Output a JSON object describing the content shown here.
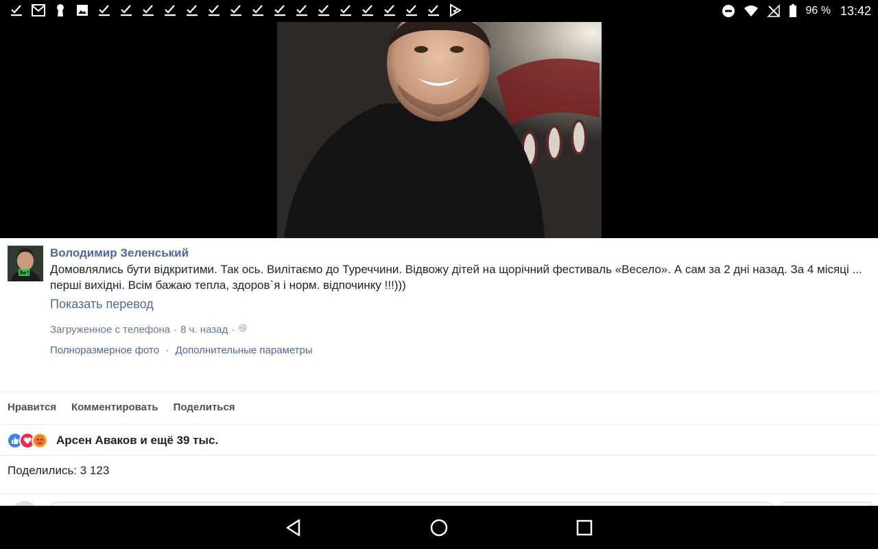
{
  "status_bar": {
    "notification_icons": [
      "check-icon",
      "gmail-icon",
      "keyhole-icon",
      "image-icon",
      "check-icon",
      "check-icon",
      "check-icon",
      "check-icon",
      "check-icon",
      "check-icon",
      "check-icon",
      "check-icon",
      "check-icon",
      "check-icon",
      "check-icon",
      "check-icon",
      "check-icon",
      "check-icon",
      "check-icon",
      "check-icon",
      "play-check-icon"
    ],
    "battery_percent": "96 %",
    "time": "13:42"
  },
  "post": {
    "author": "Володимир Зеленський",
    "text": "Домовлялись бути відкритими. Так ось. Вилітаємо до Туреччини. Відвожу дітей на щорічний фестиваль «Весело». А сам за 2 дні назад. За 4 місяці ... перші вихідні. Всім бажаю тепла, здоров`я і норм. відпочинку !!!)))",
    "translate_link": "Показать перевод",
    "meta": {
      "source": "Загруженное с телефона",
      "time_ago": "8 ч. назад",
      "separator": "·"
    },
    "links": {
      "full_photo": "Полноразмерное фото",
      "more_options": "Дополнительные параметры"
    },
    "actions": {
      "like": "Нравится",
      "comment": "Комментировать",
      "share": "Поделиться"
    },
    "reactions_text": "Арсен Аваков и ещё 39 тыс.",
    "shares_text": "Поделились: 3 123"
  },
  "colors": {
    "link_blue": "#4b67a1",
    "like_blue": "#3b82f6",
    "love_red": "#f0284a",
    "angry_orange": "#f7b125"
  }
}
